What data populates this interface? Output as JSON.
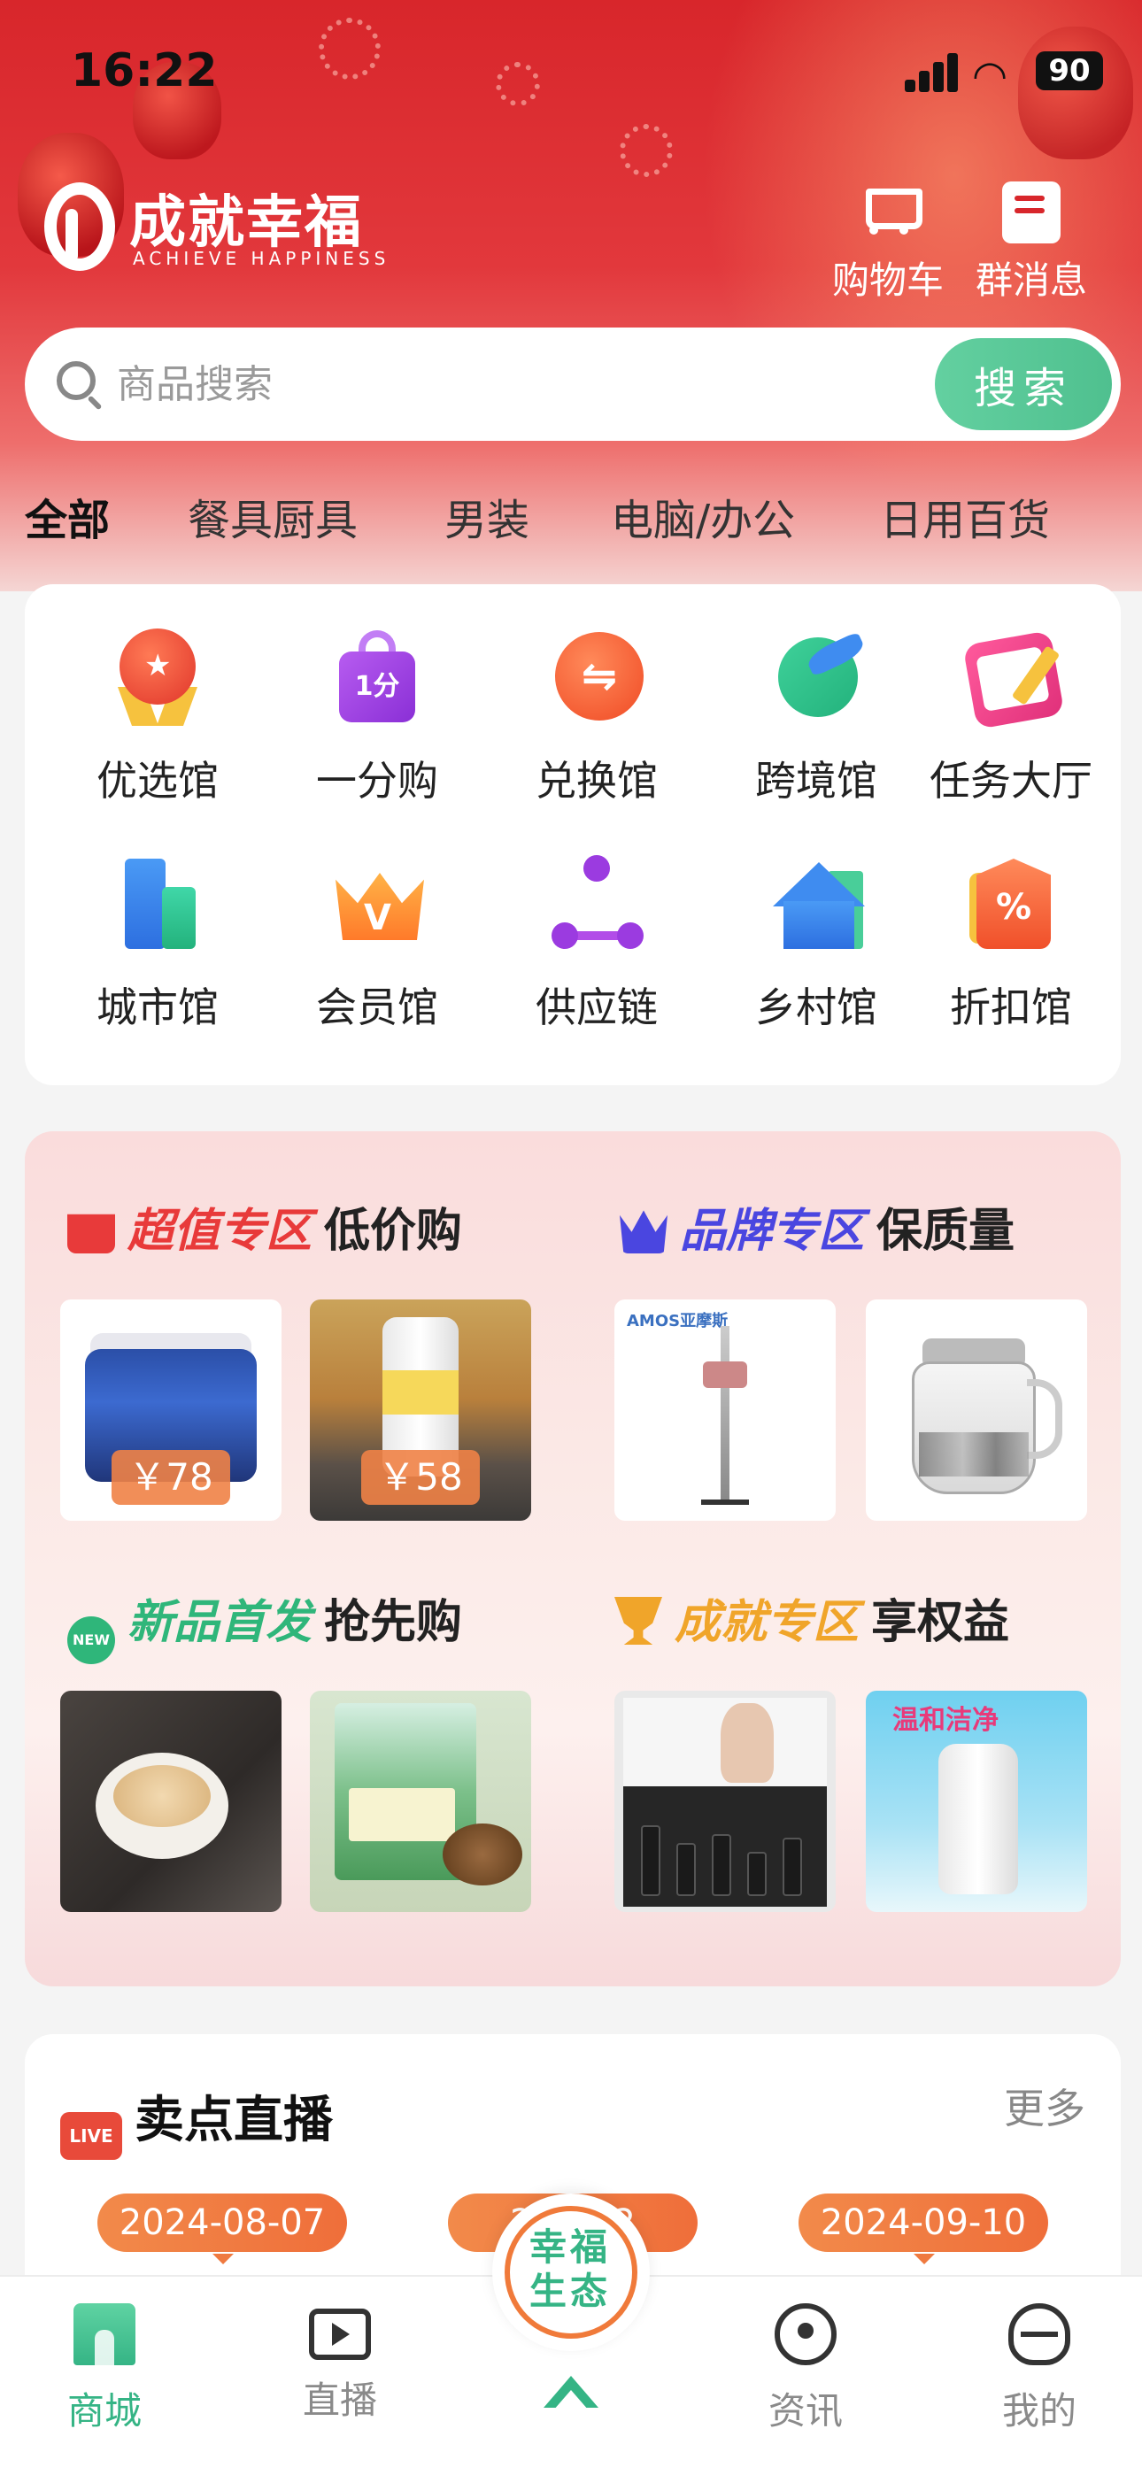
{
  "status_bar": {
    "time": "16:22",
    "battery": "90"
  },
  "brand": {
    "name": "成就幸福",
    "tagline": "ACHIEVE HAPPINESS"
  },
  "header_actions": [
    {
      "label": "购物车",
      "icon": "cart-icon"
    },
    {
      "label": "群消息",
      "icon": "message-icon"
    }
  ],
  "search": {
    "placeholder": "商品搜索",
    "button_label": "搜索"
  },
  "categories": [
    "全部",
    "餐具厨具",
    "男装",
    "电脑/办公",
    "日用百货"
  ],
  "quick_entries": [
    {
      "label": "优选馆",
      "icon": "medal-icon"
    },
    {
      "label": "一分购",
      "icon": "shopping-bag-icon",
      "badge": "1分"
    },
    {
      "label": "兑换馆",
      "icon": "exchange-icon"
    },
    {
      "label": "跨境馆",
      "icon": "plane-icon"
    },
    {
      "label": "任务大厅",
      "icon": "calendar-icon"
    },
    {
      "label": "城市馆",
      "icon": "building-icon"
    },
    {
      "label": "会员馆",
      "icon": "crown-icon"
    },
    {
      "label": "供应链",
      "icon": "network-icon"
    },
    {
      "label": "乡村馆",
      "icon": "house-icon"
    },
    {
      "label": "折扣馆",
      "icon": "discount-tag-icon"
    }
  ],
  "zones": [
    {
      "title": "超值专区",
      "subtitle": "低价购",
      "color": "#e83a3a",
      "icon": "gift-icon",
      "products": [
        {
          "price": "￥78"
        },
        {
          "price": "￥58"
        }
      ]
    },
    {
      "title": "品牌专区",
      "subtitle": "保质量",
      "color": "#4a46e0",
      "icon": "crown-icon",
      "products": [
        {
          "brand": "AMOS亚摩斯"
        },
        {}
      ]
    },
    {
      "title": "新品首发",
      "subtitle": "抢先购",
      "color": "#2fb67a",
      "icon": "new-badge-icon",
      "badge": "NEW",
      "products": [
        {},
        {}
      ]
    },
    {
      "title": "成就专区",
      "subtitle": "享权益",
      "color": "#f0a52a",
      "icon": "trophy-icon",
      "products": [
        {},
        {
          "label": "温和洁净"
        }
      ]
    }
  ],
  "live": {
    "title": "卖点直播",
    "icon_label": "LIVE",
    "more": "更多",
    "dates": [
      "2024-08-07",
      "20…22",
      "2024-09-10"
    ]
  },
  "center_button": {
    "label": "幸福生态"
  },
  "tabs": [
    {
      "label": "商城",
      "active": true
    },
    {
      "label": "直播",
      "active": false
    },
    {
      "label": "资讯",
      "active": false
    },
    {
      "label": "我的",
      "active": false
    }
  ],
  "colors": {
    "accent": "#35b485",
    "header_red": "#d8262b",
    "price_orange": "#f08246"
  }
}
